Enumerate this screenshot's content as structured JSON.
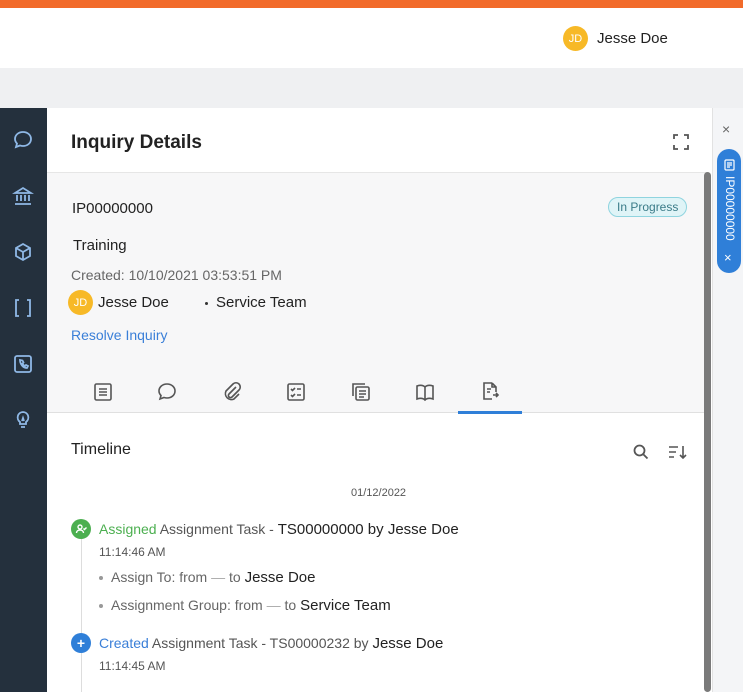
{
  "header": {
    "user_initials": "JD",
    "user_name": "Jesse Doe"
  },
  "panel": {
    "title": "Inquiry Details",
    "inquiry_id": "IP00000000",
    "status": "In Progress",
    "subject": "Training",
    "created": "Created: 10/10/2021 03:53:51 PM",
    "assignee_initials": "JD",
    "assignee_name": "Jesse Doe",
    "team": "Service Team",
    "resolve_link": "Resolve Inquiry",
    "tabs": [
      "notes-icon",
      "chat-icon",
      "attachment-icon",
      "checklist-icon",
      "copy-icon",
      "book-icon",
      "activity-icon"
    ],
    "active_tab_index": 6
  },
  "timeline": {
    "title": "Timeline",
    "date": "01/12/2022",
    "events": [
      {
        "verb": "Assigned",
        "text": " Assignment Task - ",
        "ref": "TS00000000 by Jesse Doe",
        "time": "11:14:46 AM",
        "details": [
          {
            "label": "Assign To: from ",
            "dash": "—",
            "to": " to ",
            "value": "Jesse Doe"
          },
          {
            "label": "Assignment Group: from ",
            "dash": "—",
            "to": " to ",
            "value": "Service Team"
          }
        ]
      },
      {
        "verb": "Created",
        "text": " Assignment Task - TS00000232 by ",
        "ref": "Jesse Doe",
        "time": "11:14:45 AM"
      }
    ]
  },
  "rail": {
    "tab_label": "IP00000000",
    "tab_close": "×",
    "close": "×"
  },
  "colors": {
    "brand_orange": "#f26b2a",
    "sidenav": "#24303d",
    "accent_blue": "#2f7fd8",
    "assigned_green": "#4caf50",
    "avatar_yellow": "#f7b927"
  }
}
